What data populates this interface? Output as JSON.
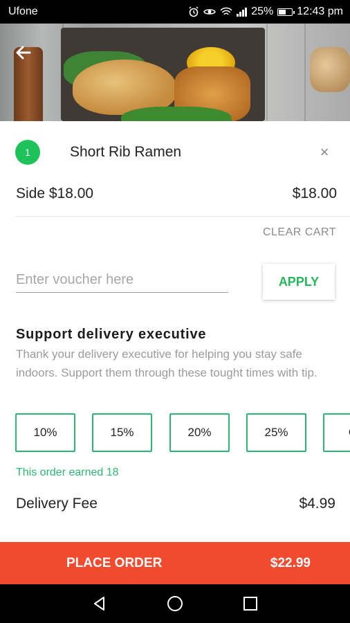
{
  "status_bar": {
    "carrier": "Ufone",
    "battery": "25%",
    "time": "12:43 pm"
  },
  "cart_item": {
    "quantity": "1",
    "name": "Short Rib Ramen",
    "remove_symbol": "×",
    "side_label": "Side $18.00",
    "price": "$18.00"
  },
  "clear_cart_label": "CLEAR CART",
  "voucher": {
    "placeholder": "Enter voucher here",
    "apply_label": "APPLY"
  },
  "tip": {
    "title": "Support delivery executive",
    "description": "Thank your delivery executive for helping you stay safe indoors. Support them through these tought times with tip.",
    "options": [
      "10%",
      "15%",
      "20%",
      "25%",
      "O"
    ],
    "earned_text": "This order earned 18"
  },
  "delivery_fee": {
    "label": "Delivery Fee",
    "value": "$4.99"
  },
  "place_order": {
    "label": "PLACE ORDER",
    "total": "$22.99"
  },
  "icons": {
    "back": "arrow-left-icon",
    "remove": "close-icon",
    "nav_back": "triangle-back-icon",
    "nav_home": "circle-home-icon",
    "nav_recent": "square-recents-icon"
  },
  "colors": {
    "accent_green": "#2bb673",
    "badge_green": "#1fc15b",
    "order_red": "#f04b2e"
  }
}
